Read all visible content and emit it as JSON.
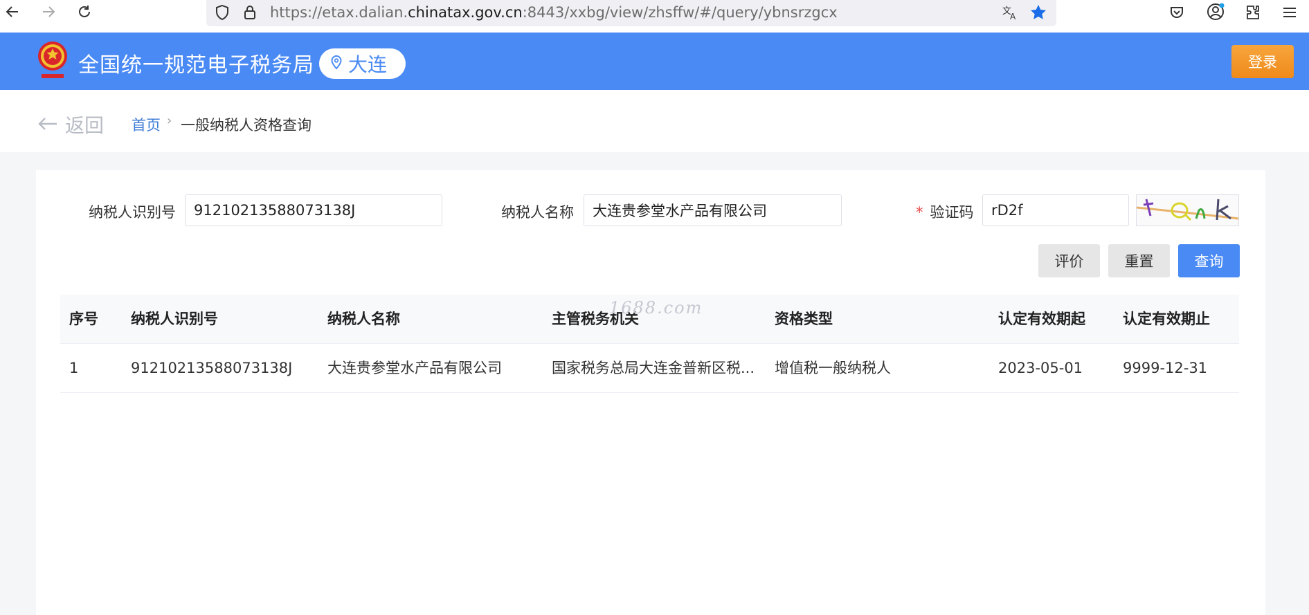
{
  "browser": {
    "url_prefix": "https://etax.dalian.",
    "url_domain": "chinatax.gov.cn",
    "url_suffix": ":8443/xxbg/view/zhsffw/#/query/ybnsrzgcx"
  },
  "header": {
    "site_title": "全国统一规范电子税务局",
    "region": "大连",
    "login_label": "登录"
  },
  "breadcrumb": {
    "back_label": "返回",
    "home": "首页",
    "separator": "›",
    "current": "一般纳税人资格查询"
  },
  "form": {
    "taxpayer_id_label": "纳税人识别号",
    "taxpayer_id_value": "91210213588073138J",
    "taxpayer_name_label": "纳税人名称",
    "taxpayer_name_value": "大连贵参堂水产品有限公司",
    "captcha_required_mark": "*",
    "captcha_label": "验证码",
    "captcha_value": "rD2f"
  },
  "actions": {
    "evaluate_label": "评价",
    "reset_label": "重置",
    "query_label": "查询"
  },
  "table": {
    "columns": [
      "序号",
      "纳税人识别号",
      "纳税人名称",
      "主管税务机关",
      "资格类型",
      "认定有效期起",
      "认定有效期止"
    ],
    "rows": [
      [
        "1",
        "91210213588073138J",
        "大连贵参堂水产品有限公司",
        "国家税务总局大连金普新区税...",
        "增值税一般纳税人",
        "2023-05-01",
        "9999-12-31"
      ]
    ]
  },
  "watermark": "1688.com",
  "colors": {
    "header_blue": "#4a8af4",
    "login_orange": "#f0901f",
    "link_blue": "#3f7cd6",
    "required_red": "#e64c4c"
  }
}
